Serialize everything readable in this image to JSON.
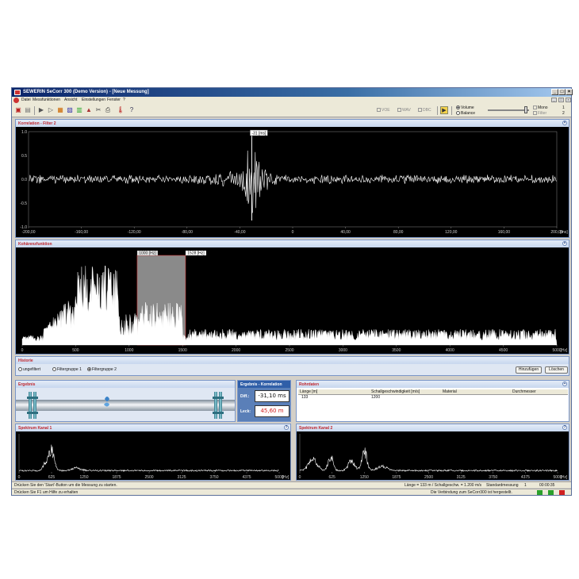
{
  "window": {
    "title": "SEWERIN SeCorr 300 (Demo Version) - [Neue Messung]",
    "buttons": [
      "_",
      "□",
      "×"
    ],
    "mdi_buttons": [
      "_",
      "□",
      "×"
    ]
  },
  "menu": [
    "Datei",
    "Messfunktionen",
    "Ansicht",
    "Einstellungen",
    "Fenster",
    "?"
  ],
  "toolbar": {
    "checkboxes": [
      "VOE",
      "WAV",
      "DBC"
    ],
    "radios": [
      {
        "label": "Volume",
        "checked": true
      },
      {
        "label": "Balance",
        "checked": false
      }
    ],
    "mono_label": "Mono",
    "filter_label": "Filter",
    "right_nums": [
      "1",
      "2"
    ]
  },
  "korrelation": {
    "title": "Korrelation - Filter 2",
    "marker": "-31 [ms]",
    "y_ticks": [
      "1.0",
      "0.5",
      "0.0",
      "-0.5",
      "-1.0"
    ],
    "x_ticks": [
      "-200,00",
      "-160,00",
      "-120,00",
      "-80,00",
      "-40,00",
      "0",
      "40,00",
      "80,00",
      "120,00",
      "160,00",
      "200,00"
    ],
    "x_unit": "[ms]"
  },
  "kohaerenz": {
    "title": "Kohärenzfunktion",
    "left_marker": "1000 [Hz]",
    "right_marker": "1528 [Hz]",
    "x_ticks": [
      "0",
      "500",
      "1000",
      "1500",
      "2000",
      "2500",
      "3000",
      "3500",
      "4000",
      "4500",
      "5000"
    ],
    "x_unit": "[Hz]"
  },
  "historie": {
    "title": "Historie",
    "radios": [
      {
        "label": "ungefiltert",
        "checked": false
      },
      {
        "label": "Filtergruppe 1",
        "checked": false
      },
      {
        "label": "Filtergruppe 2",
        "checked": true
      }
    ],
    "add_button": "Hinzufügen",
    "delete_button": "Löschen"
  },
  "ergebnis": {
    "title": "Ergebnis"
  },
  "ergebnis_korrelation": {
    "title": "Ergebnis - Korrelation",
    "diff_label": "Diff.:",
    "diff_value": "-31,10 ms",
    "leck_label": "Leck:",
    "leck_value": "45,60 m"
  },
  "rohrdaten": {
    "title": "Rohrdaten",
    "columns": [
      "Länge [m]",
      "Schallgeschwindigkeit [m/s]",
      "Material",
      "Durchmesser"
    ],
    "rows": [
      [
        "133",
        "1200",
        "",
        ""
      ]
    ]
  },
  "spektrum1": {
    "title": "Spektrum Kanal 1",
    "x_ticks": [
      "0",
      "625",
      "1250",
      "1875",
      "2500",
      "3125",
      "3750",
      "4375",
      "5000"
    ],
    "x_unit": "[Hz]"
  },
  "spektrum2": {
    "title": "Spektrum Kanal 2",
    "x_ticks": [
      "0",
      "625",
      "1250",
      "1875",
      "2500",
      "3125",
      "3750",
      "4375",
      "5000"
    ],
    "x_unit": "[Hz]"
  },
  "status1": {
    "left": "Drücken Sie den 'Start'-Button um die Messung zu starten.",
    "middle": "Länge = 133 m / Schallgeschw. = 1.200 m/s",
    "mode": "Standardmessung",
    "count": "1",
    "time": "00:00:35"
  },
  "status2": {
    "left": "Drücken Sie F1 um Hilfe zu erhalten",
    "right": "Die Verbindung zum SeCorr300 ist hergestellt.",
    "lamp_colors": [
      "#2aa02a",
      "#2aa02a",
      "#d02020"
    ]
  }
}
